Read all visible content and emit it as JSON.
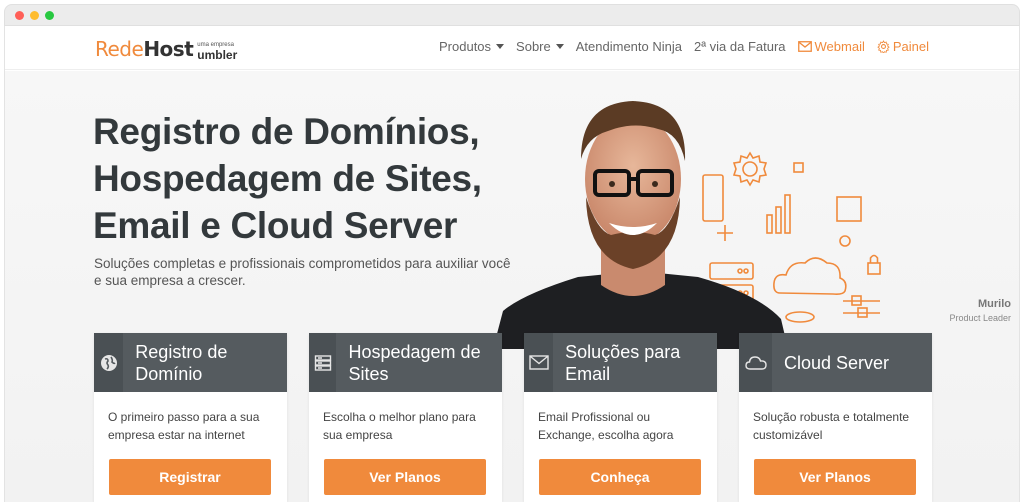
{
  "brand": {
    "logo_rede": "Rede",
    "logo_host": "Host",
    "logo_sub_small": "uma empresa",
    "logo_sub_umbler": "umbler"
  },
  "nav": {
    "produtos": "Produtos",
    "sobre": "Sobre",
    "atendimento": "Atendimento Ninja",
    "fatura": "2ª via da Fatura",
    "webmail": "Webmail",
    "painel": "Painel"
  },
  "hero": {
    "title_lines": [
      "Registro de Domínios,",
      "Hospedagem de Sites,",
      "Email e Cloud Server"
    ],
    "subtitle": "Soluções completas e profissionais comprometidos para auxiliar você e sua empresa a crescer.",
    "person_name": "Murilo",
    "person_role": "Product Leader"
  },
  "cards": [
    {
      "title": "Registro de Domínio",
      "desc": "O primeiro passo para a sua empresa estar na internet",
      "button": "Registrar",
      "icon": "globe-icon"
    },
    {
      "title": "Hospedagem de Sites",
      "desc": "Escolha o melhor plano para sua empresa",
      "button": "Ver Planos",
      "icon": "server-icon"
    },
    {
      "title": "Soluções para Email",
      "desc": "Email Profissional ou Exchange, escolha agora",
      "button": "Conheça",
      "icon": "envelope-icon"
    },
    {
      "title": "Cloud Server",
      "desc": "Solução robusta e totalmente customizável",
      "button": "Ver Planos",
      "icon": "cloud-icon"
    }
  ],
  "colors": {
    "accent": "#f08a3c",
    "card_header": "#555b5f",
    "title_text": "#33393c"
  }
}
